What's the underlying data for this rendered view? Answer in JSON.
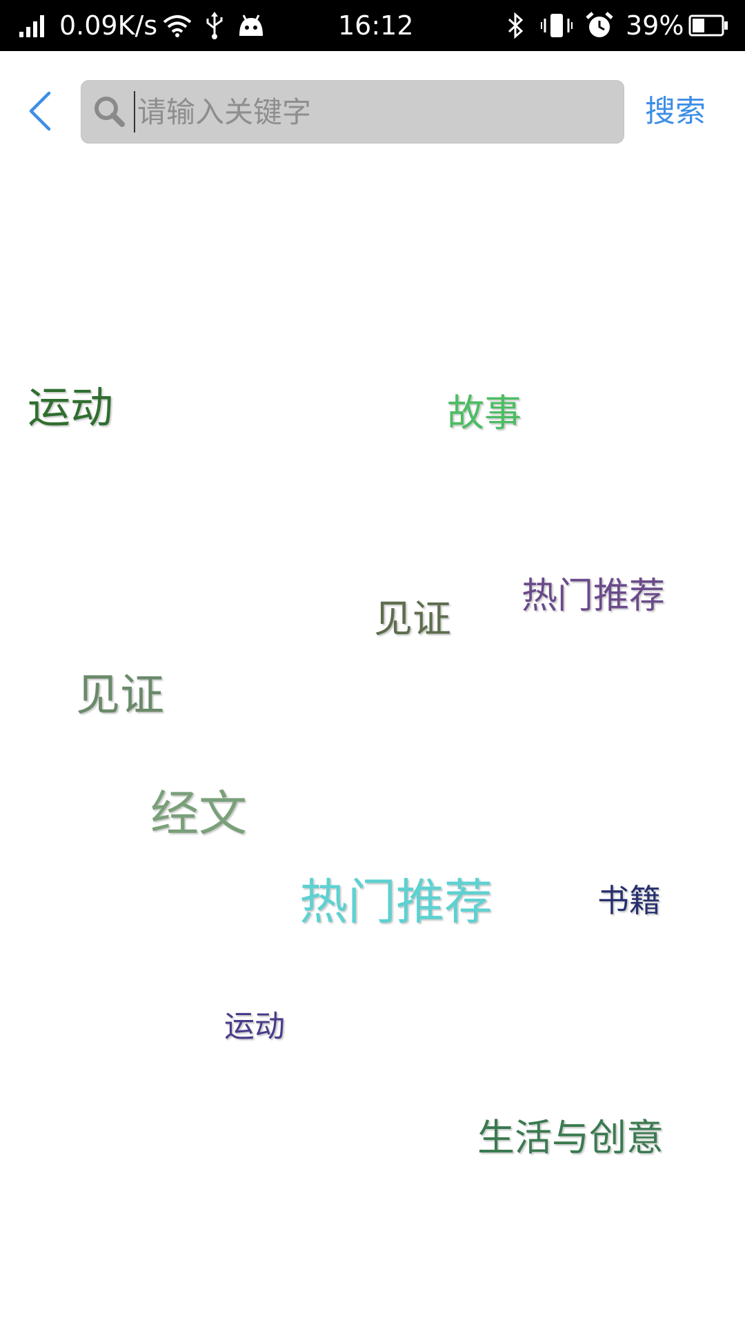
{
  "status_bar": {
    "net_speed": "0.09K/s",
    "time": "16:12",
    "battery": "39%"
  },
  "search": {
    "placeholder": "请输入关键字",
    "value": "",
    "button_label": "搜索"
  },
  "tags": [
    {
      "label": "运动",
      "color": "#2f6e2f"
    },
    {
      "label": "故事",
      "color": "#4cbd63"
    },
    {
      "label": "热门推荐",
      "color": "#6a4a8a"
    },
    {
      "label": "见证",
      "color": "#5e6e4e"
    },
    {
      "label": "见证",
      "color": "#6a8a6a"
    },
    {
      "label": "经文",
      "color": "#7aa07a"
    },
    {
      "label": "热门推荐",
      "color": "#5ed1d1"
    },
    {
      "label": "书籍",
      "color": "#27306e"
    },
    {
      "label": "运动",
      "color": "#4a3a8a"
    },
    {
      "label": "生活与创意",
      "color": "#3a7a50"
    }
  ]
}
